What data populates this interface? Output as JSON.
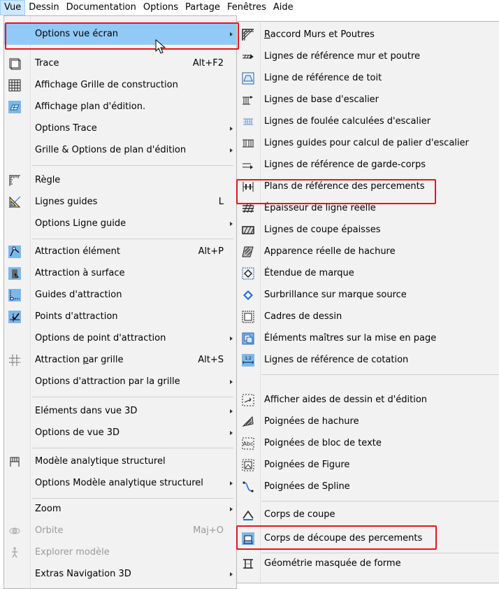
{
  "menubar": [
    {
      "label": "Vue",
      "active": true
    },
    {
      "label": "Dessin"
    },
    {
      "label": "Documentation"
    },
    {
      "label": "Options"
    },
    {
      "label": "Partage"
    },
    {
      "label": "Fenêtres"
    },
    {
      "label": "Aide"
    }
  ],
  "vue_menu": [
    {
      "label": "Options vue écran",
      "submenu": true,
      "selected": true
    },
    {
      "label": "Trace",
      "shortcut": "Alt+F2",
      "icon": "trace-icon"
    },
    {
      "label": "Affichage Grille de construction",
      "icon": "construction-grid-icon"
    },
    {
      "label": "Affichage plan d'édition.",
      "icon": "editing-plane-icon"
    },
    {
      "label": "Options Trace",
      "submenu": true
    },
    {
      "label": "Grille & Options de plan d'édition",
      "submenu": true
    },
    {
      "label": "Règle",
      "icon": "ruler-icon"
    },
    {
      "label": "Lignes guides",
      "shortcut": "L",
      "icon": "guide-lines-icon"
    },
    {
      "label": "Options Ligne guide",
      "submenu": true
    },
    {
      "label": "Attraction élément",
      "shortcut": "Alt+P",
      "icon": "element-snap-icon"
    },
    {
      "label": "Attraction à surface",
      "icon": "surface-snap-icon"
    },
    {
      "label": "Guides d'attraction",
      "icon": "snap-guides-icon"
    },
    {
      "label": "Points d'attraction",
      "icon": "snap-points-icon"
    },
    {
      "label": "Options de point d'attraction",
      "submenu": true
    },
    {
      "label": "Attraction par grille",
      "shortcut": "Alt+S",
      "icon": "grid-snap-icon"
    },
    {
      "label": "Options d'attraction par la grille",
      "submenu": true
    },
    {
      "label": "Eléments dans vue 3D",
      "submenu": true
    },
    {
      "label": "Options de vue 3D",
      "submenu": true
    },
    {
      "label": "Modèle analytique structurel",
      "icon": "structural-model-icon"
    },
    {
      "label": "Options Modèle analytique structurel",
      "submenu": true
    },
    {
      "label": "Zoom",
      "submenu": true
    },
    {
      "label": "Orbite",
      "shortcut": "Maj+O",
      "icon": "orbit-icon",
      "disabled": true
    },
    {
      "label": "Explorer modèle",
      "icon": "explore-icon",
      "disabled": true
    },
    {
      "label": "Extras Navigation 3D",
      "submenu": true
    }
  ],
  "sub_menu": [
    {
      "label": "Raccord Murs et Poutres",
      "icon": "wall-beam-join-icon"
    },
    {
      "label": "Lignes de référence mur et poutre",
      "icon": "wall-reference-line-icon"
    },
    {
      "label": "Ligne de référence de toit",
      "icon": "roof-reference-icon"
    },
    {
      "label": "Lignes de base d'escalier",
      "icon": "stair-baseline-icon"
    },
    {
      "label": "Lignes de foulée calculées d'escalier",
      "icon": "stair-walkline-icon"
    },
    {
      "label": "Lignes guides pour calcul de palier d'escalier",
      "icon": "stair-landing-icon"
    },
    {
      "label": "Lignes de référence de garde-corps",
      "icon": "railing-reference-icon"
    },
    {
      "label": "Plans de référence des percements",
      "icon": "opening-reference-icon"
    },
    {
      "label": "Épaisseur de ligne réelle",
      "icon": "true-line-weight-icon"
    },
    {
      "label": "Lignes de coupe épaisses",
      "icon": "bold-cut-lines-icon"
    },
    {
      "label": "Apparence réelle de hachure",
      "icon": "vectorial-hatching-icon"
    },
    {
      "label": "Étendue de marque",
      "icon": "marker-range-icon"
    },
    {
      "label": "Surbrillance sur marque source",
      "icon": "source-marker-icon"
    },
    {
      "label": "Cadres de dessin",
      "icon": "drawing-frames-icon"
    },
    {
      "label": "Éléments maîtres sur la mise en page",
      "icon": "master-layout-icon"
    },
    {
      "label": "Lignes de référence de cotation",
      "icon": "dimension-reference-icon"
    },
    {
      "label": "Afficher aides de dessin et d'édition",
      "icon": "drawing-aids-icon"
    },
    {
      "label": "Poignées de hachure",
      "icon": "hatch-handles-icon"
    },
    {
      "label": "Poignées de bloc de texte",
      "icon": "text-block-handles-icon"
    },
    {
      "label": "Poignées de Figure",
      "icon": "figure-handles-icon"
    },
    {
      "label": "Poignées de Spline",
      "icon": "spline-handles-icon"
    },
    {
      "label": "Corps de coupe",
      "icon": "cutting-body-icon"
    },
    {
      "label": "Corps de découpe des percements",
      "icon": "opening-cutting-body-icon"
    },
    {
      "label": "Géométrie masquée de forme",
      "icon": "hidden-geometry-icon"
    }
  ]
}
